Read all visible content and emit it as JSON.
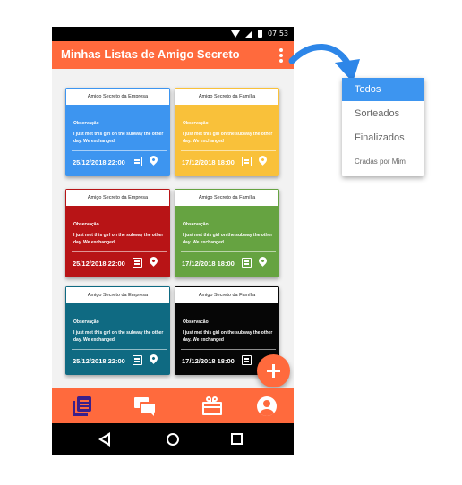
{
  "status_bar": {
    "time": "07:53"
  },
  "app_bar": {
    "title": "Minhas Listas de Amigo Secreto"
  },
  "cards": [
    {
      "header": "Amigo Secreto da Empresa",
      "obs_label": "Observação",
      "text": "I just met this girl on the subway the other day. We exchanged",
      "date": "25/12/2018 22:00",
      "color": "#3d95f0"
    },
    {
      "header": "Amigo Secreto da Família",
      "obs_label": "Observação",
      "text": "I just met this girl on the subway the other day. We exchanged",
      "date": "17/12/2018 18:00",
      "color": "#f9c13a"
    },
    {
      "header": "Amigo Secreto da Empresa",
      "obs_label": "Observação",
      "text": "I just met this girl on the subway the other day. We exchanged",
      "date": "25/12/2018 22:00",
      "color": "#b81416"
    },
    {
      "header": "Amigo Secreto da Família",
      "obs_label": "Observação",
      "text": "I just met this girl on the subway the other day. We exchanged",
      "date": "17/12/2018 18:00",
      "color": "#66a341"
    },
    {
      "header": "Amigo Secreto da Empresa",
      "obs_label": "Observação",
      "text": "I just met this girl on the subway the other day. We exchanged",
      "date": "25/12/2018 22:00",
      "color": "#0f6a82"
    },
    {
      "header": "Amigo Secreto da Família",
      "obs_label": "Observacão",
      "text": "I just met this girl on the subway the other day. We exchanged",
      "date": "17/12/2018 18:00",
      "color": "#060606"
    }
  ],
  "menu": {
    "items": [
      "Todos",
      "Sorteados",
      "Finalizados",
      "Cradas por Mim"
    ],
    "selected": "Todos"
  },
  "colors": {
    "accent": "#ff6a3d",
    "menu_highlight": "#3d95f0",
    "arrow": "#2d86e8"
  },
  "icons": [
    "wifi-icon",
    "signal-icon",
    "battery-icon",
    "more-vert-icon",
    "calendar-icon",
    "location-pin-icon",
    "add-icon",
    "library-books-icon",
    "forum-icon",
    "gift-card-icon",
    "account-circle-icon",
    "back-icon",
    "home-icon",
    "recents-icon"
  ]
}
